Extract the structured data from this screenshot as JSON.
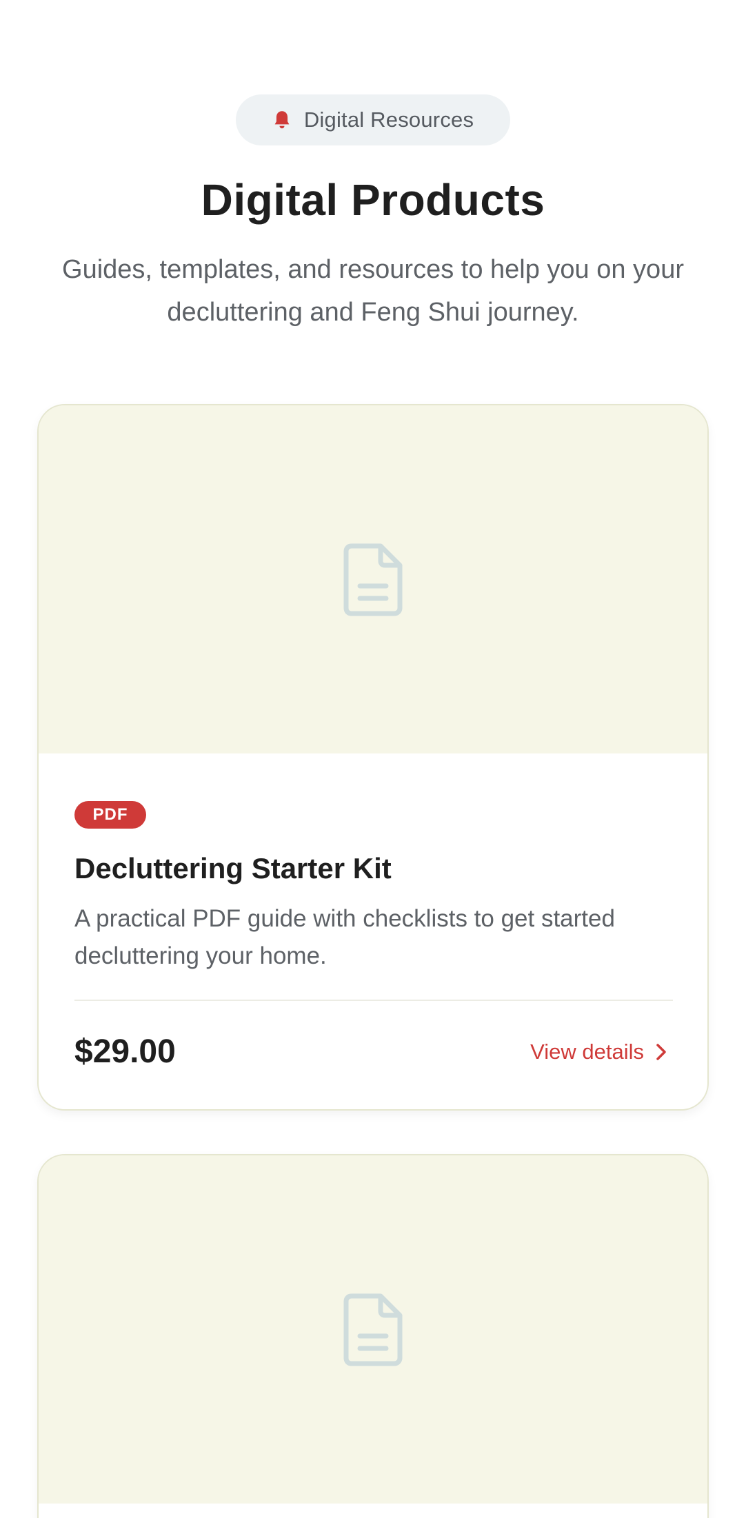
{
  "header": {
    "pill_label": "Digital Resources",
    "pill_icon": "bell-icon",
    "title": "Digital Products",
    "subtitle": "Guides, templates, and resources to help you on your decluttering and Feng Shui journey."
  },
  "colors": {
    "accent": "#cf3a38",
    "media_background": "#f6f6e7",
    "pill_background": "#eef2f4",
    "placeholder_icon": "#cfdcdc"
  },
  "products": [
    {
      "badge": "PDF",
      "title": "Decluttering Starter Kit",
      "description": "A practical PDF guide with checklists to get started decluttering your home.",
      "price": "$29.00",
      "action_label": "View details",
      "media_icon": "document-icon"
    },
    {
      "media_icon": "document-icon"
    }
  ]
}
